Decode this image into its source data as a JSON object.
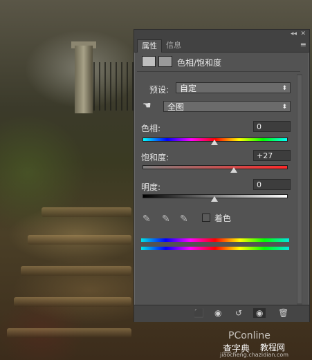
{
  "panel": {
    "tabs": [
      {
        "label": "属性"
      },
      {
        "label": "信息"
      }
    ],
    "title": "色相/饱和度",
    "preset_label": "预设:",
    "preset_value": "自定",
    "channel_value": "全图",
    "hue_label": "色相:",
    "hue_value": "0",
    "saturation_label": "饱和度:",
    "saturation_value": "+27",
    "lightness_label": "明度:",
    "lightness_value": "0",
    "colorize_label": "着色",
    "colorize_checked": false
  },
  "sliders": {
    "hue": 0,
    "hue_range": [
      -180,
      180
    ],
    "saturation": 27,
    "saturation_range": [
      -100,
      100
    ],
    "lightness": 0,
    "lightness_range": [
      -100,
      100
    ]
  },
  "icons": {
    "titlebar": [
      "collapse-icon",
      "close-icon"
    ],
    "panel_menu": "panel-menu-icon",
    "header": [
      "adjustment-layer-icon",
      "mask-icon"
    ],
    "hand": "targeted-adjustment-hand-icon",
    "eyedroppers": [
      "eyedropper-icon",
      "eyedropper-plus-icon",
      "eyedropper-minus-icon"
    ],
    "bottom": [
      "clip-to-layer-icon",
      "view-previous-icon",
      "reset-icon",
      "visibility-eye-icon",
      "trash-icon"
    ]
  },
  "watermark": {
    "line1": "PConline",
    "line2": "查字典",
    "line3": "教程网",
    "line4": "jiaocheng.chazidian.com"
  }
}
